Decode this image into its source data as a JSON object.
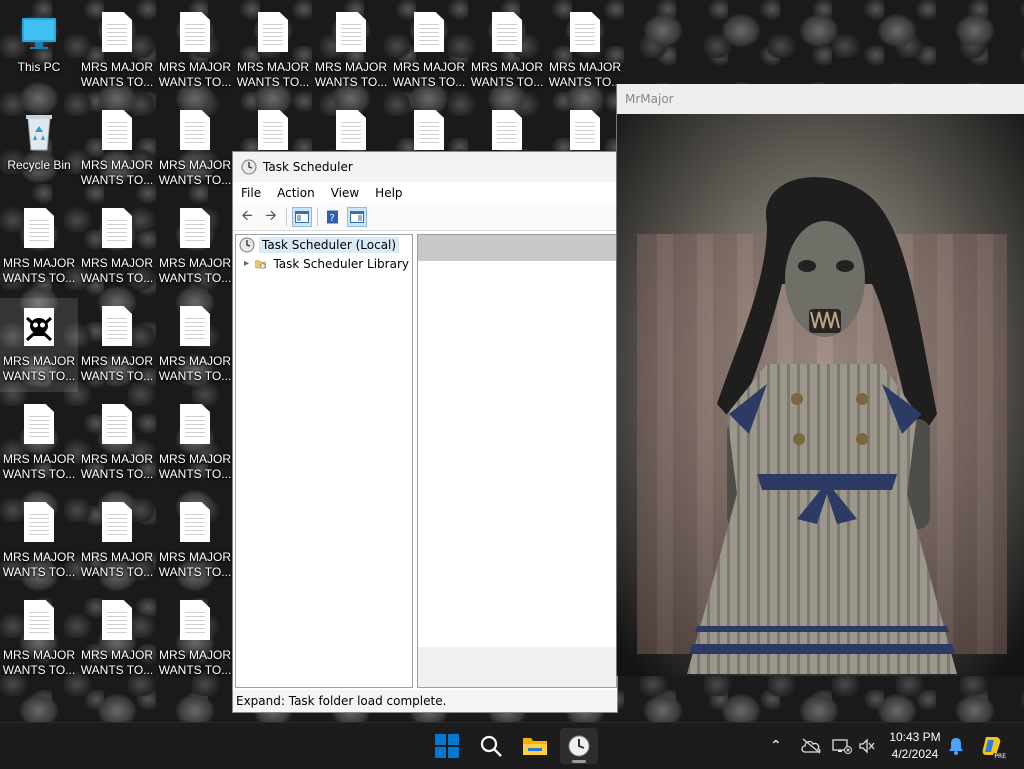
{
  "desktop": {
    "this_pc": "This PC",
    "recycle_bin": "Recycle Bin",
    "doc_label_line1": "MRS MAJOR",
    "doc_label_line2": "WANTS TO..."
  },
  "task_scheduler": {
    "title": "Task Scheduler",
    "menu": [
      "File",
      "Action",
      "View",
      "Help"
    ],
    "tree": [
      {
        "label": "Task Scheduler (Local)"
      },
      {
        "label": "Task Scheduler Library"
      }
    ],
    "status": "Expand:  Task folder load complete."
  },
  "mrmajor": {
    "title": "MrMajor"
  },
  "taskbar": {
    "time": "10:43 PM",
    "date": "4/2/2024",
    "badge": "PRE"
  },
  "colors": {
    "taskbar_bg": "#1c1c1c",
    "win_start_blue": "#0078d4",
    "tree_selection": "#d9ebf9"
  }
}
